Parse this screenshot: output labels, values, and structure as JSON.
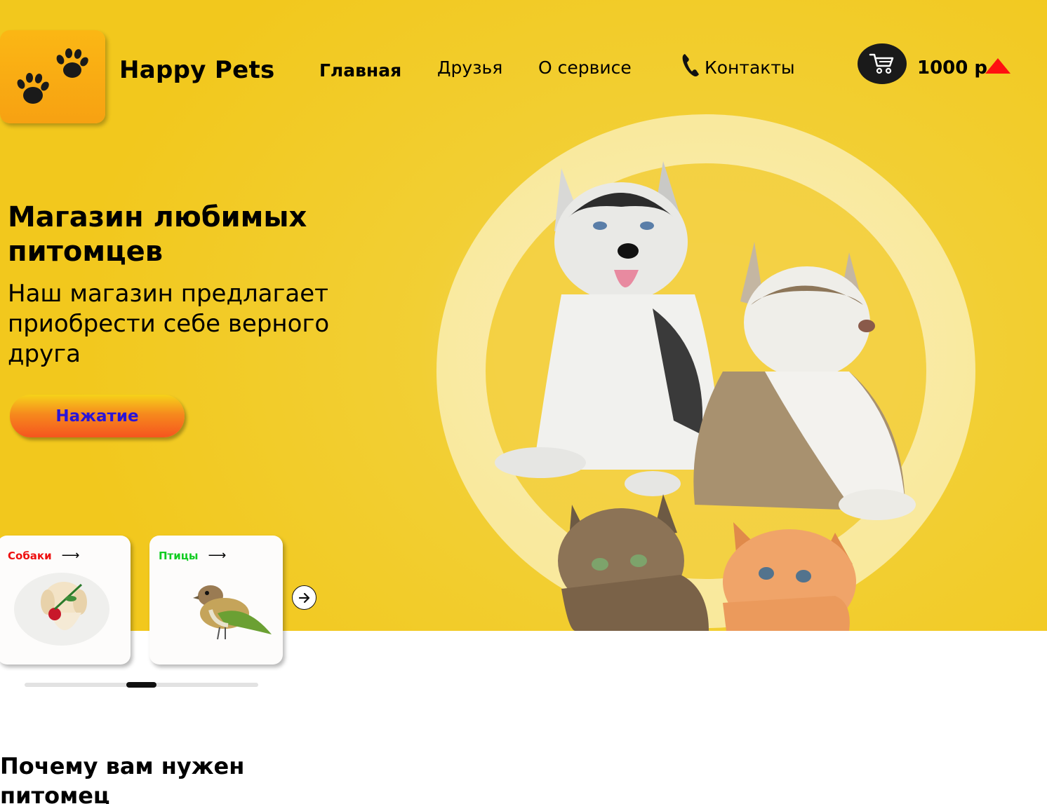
{
  "header": {
    "brand": "Happy Pets",
    "nav": {
      "home": "Главная",
      "friends": "Друзья",
      "about": "О сервисе",
      "contacts": "Контакты"
    },
    "cart": {
      "amount": "1000 р"
    }
  },
  "hero": {
    "title": "Магазин любимых питомцев",
    "subtitle": "Наш магазин предлагает приобрести себе верного друга",
    "button_label": "Нажатие"
  },
  "categories": [
    {
      "label": "Собаки",
      "arrow": "⟶",
      "color": "#ee1111"
    },
    {
      "label": "Птицы",
      "arrow": "⟶",
      "color": "#11cc22"
    }
  ],
  "carousel": {
    "progress": 0.5
  },
  "section": {
    "title": "Почему вам нужен питомец"
  },
  "colors": {
    "hero_background": "#f2c81d",
    "logo_background": "#f7a112",
    "cart_arrow": "#ff1010",
    "button_text": "#2a14d8"
  },
  "icons": [
    "paw-icon",
    "phone-icon",
    "cart-icon",
    "arrow-right-icon",
    "triangle-up-icon"
  ]
}
